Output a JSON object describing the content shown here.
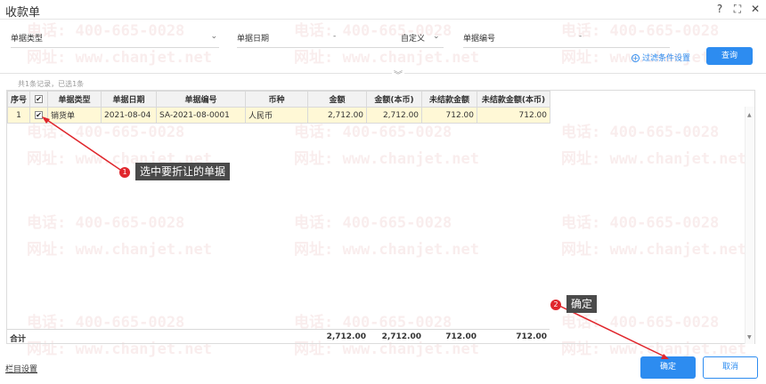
{
  "window": {
    "title": "收款单"
  },
  "filter": {
    "doc_type_label": "单据类型",
    "doc_date_label": "单据日期",
    "date_sep": "-",
    "date_mode": "自定义",
    "doc_no_label": "单据编号",
    "doc_no_sep": "-",
    "advanced_label": "过滤条件设置",
    "query_label": "查询"
  },
  "summary": "共1条记录，已选1条",
  "table": {
    "headers": [
      "序号",
      "",
      "单据类型",
      "单据日期",
      "单据编号",
      "币种",
      "金额",
      "金额(本币)",
      "未结款金额",
      "未结款金额(本币)"
    ],
    "rows": [
      {
        "no": "1",
        "checked": true,
        "type": "销货单",
        "date": "2021-08-04",
        "code": "SA-2021-08-0001",
        "currency": "人民币",
        "amount": "2,712.00",
        "amount_base": "2,712.00",
        "unsettled": "712.00",
        "unsettled_base": "712.00"
      }
    ],
    "totals": {
      "label": "合计",
      "amount": "2,712.00",
      "amount_base": "2,712.00",
      "unsettled": "712.00",
      "unsettled_base": "712.00"
    }
  },
  "footer": {
    "column_settings": "栏目设置",
    "ok": "确定",
    "cancel": "取消"
  },
  "callouts": [
    {
      "num": "1",
      "text": "选中要折让的单据"
    },
    {
      "num": "2",
      "text": "确定"
    }
  ],
  "watermark": {
    "phone": "电话: 400-665-0028",
    "site": "网址: www.chanjet.net"
  },
  "colors": {
    "accent": "#2d8cf0",
    "selected_row": "#fff8d6",
    "badge": "#e0262c"
  }
}
